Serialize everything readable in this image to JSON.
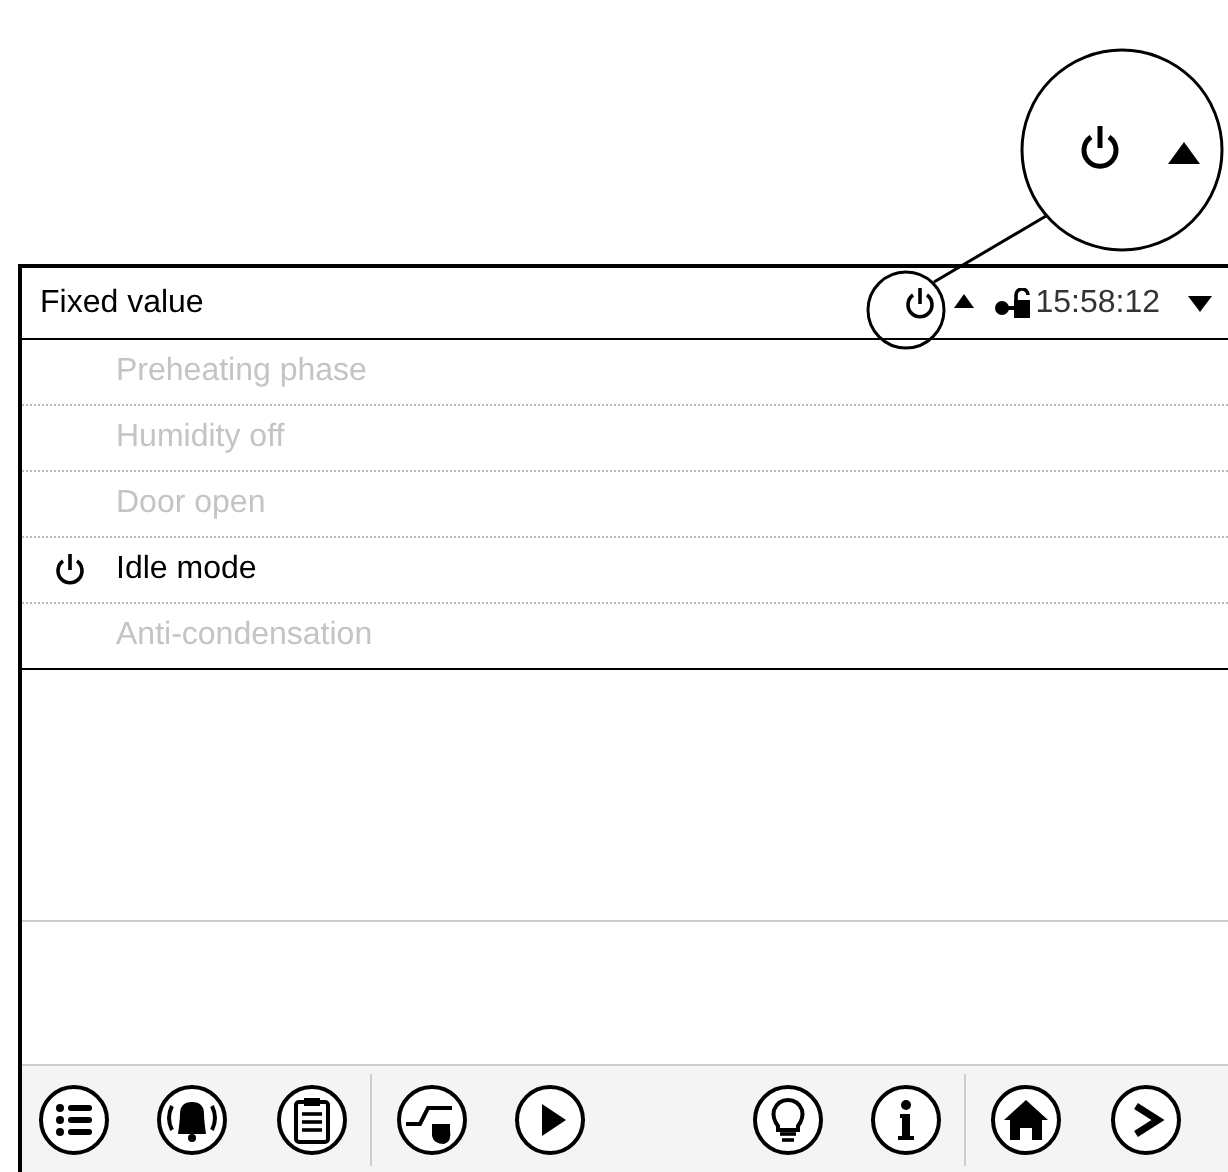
{
  "header": {
    "title": "Fixed value",
    "time": "15:58:12"
  },
  "status_menu": [
    {
      "label": "Preheating phase",
      "selected": false
    },
    {
      "label": "Humidity off",
      "selected": false
    },
    {
      "label": "Door open",
      "selected": false
    },
    {
      "label": "Idle mode",
      "selected": true
    },
    {
      "label": "Anti-condensation",
      "selected": false
    }
  ]
}
